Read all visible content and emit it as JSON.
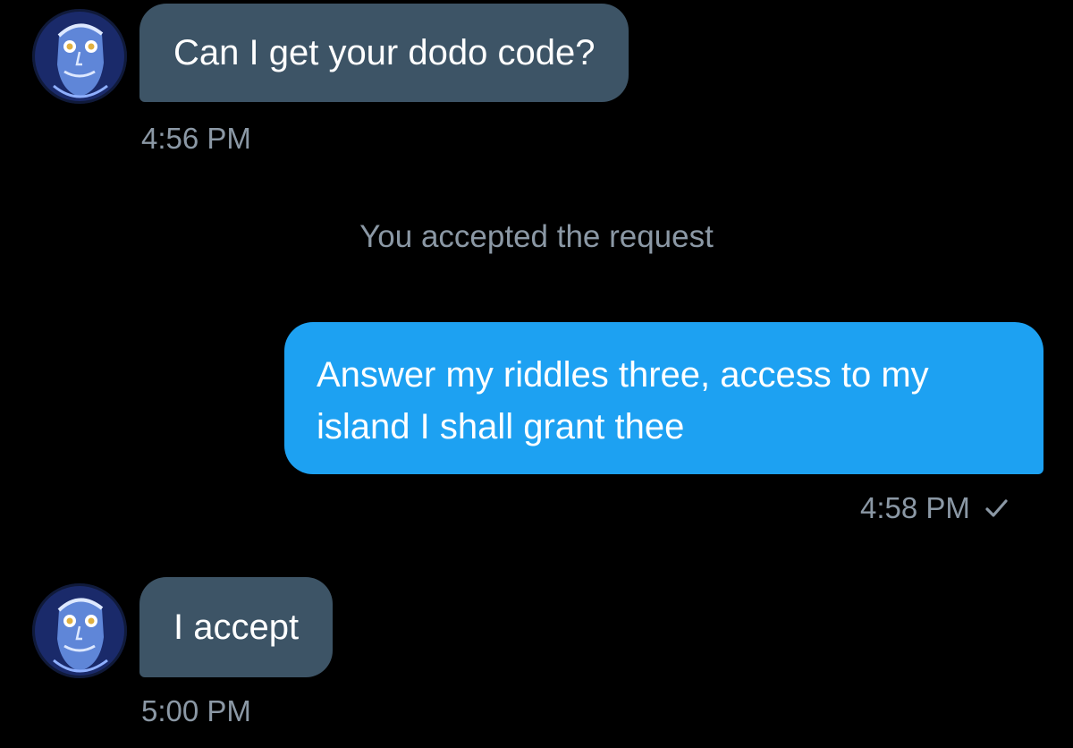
{
  "messages": [
    {
      "direction": "incoming",
      "avatar_icon": "user-avatar",
      "text": "Can I get your dodo code?",
      "time": "4:56 PM"
    },
    {
      "direction": "outgoing",
      "text": "Answer my riddles three, access to my island I shall grant thee",
      "time": "4:58 PM",
      "status_icon": "check-icon"
    },
    {
      "direction": "incoming",
      "avatar_icon": "user-avatar",
      "text": "I accept",
      "time": "5:00 PM"
    }
  ],
  "event_text": "You accepted the request",
  "colors": {
    "background": "#000000",
    "incoming_bubble": "#3d5466",
    "outgoing_bubble": "#1da1f2",
    "secondary_text": "#8b98a5"
  }
}
